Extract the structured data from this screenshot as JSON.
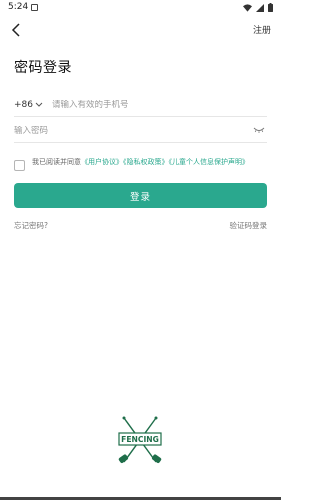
{
  "status_bar": {
    "time": "5:24"
  },
  "header": {
    "register_label": "注册"
  },
  "page": {
    "title": "密码登录"
  },
  "phone": {
    "country_code": "+86",
    "placeholder": "请输入有效的手机号"
  },
  "password": {
    "placeholder": "输入密码"
  },
  "agreement": {
    "prefix": "我已阅读并同意",
    "user_agreement": "《用户协议》",
    "privacy_policy": "《隐私权政策》",
    "child_privacy": "《儿童个人信息保护声明》"
  },
  "login_button_label": "登录",
  "forgot_password_label": "忘记密码?",
  "code_login_label": "验证码登录",
  "logo": {
    "text": "FENCING"
  },
  "colors": {
    "accent": "#2aa88e",
    "logo_green": "#1f6e4a"
  }
}
